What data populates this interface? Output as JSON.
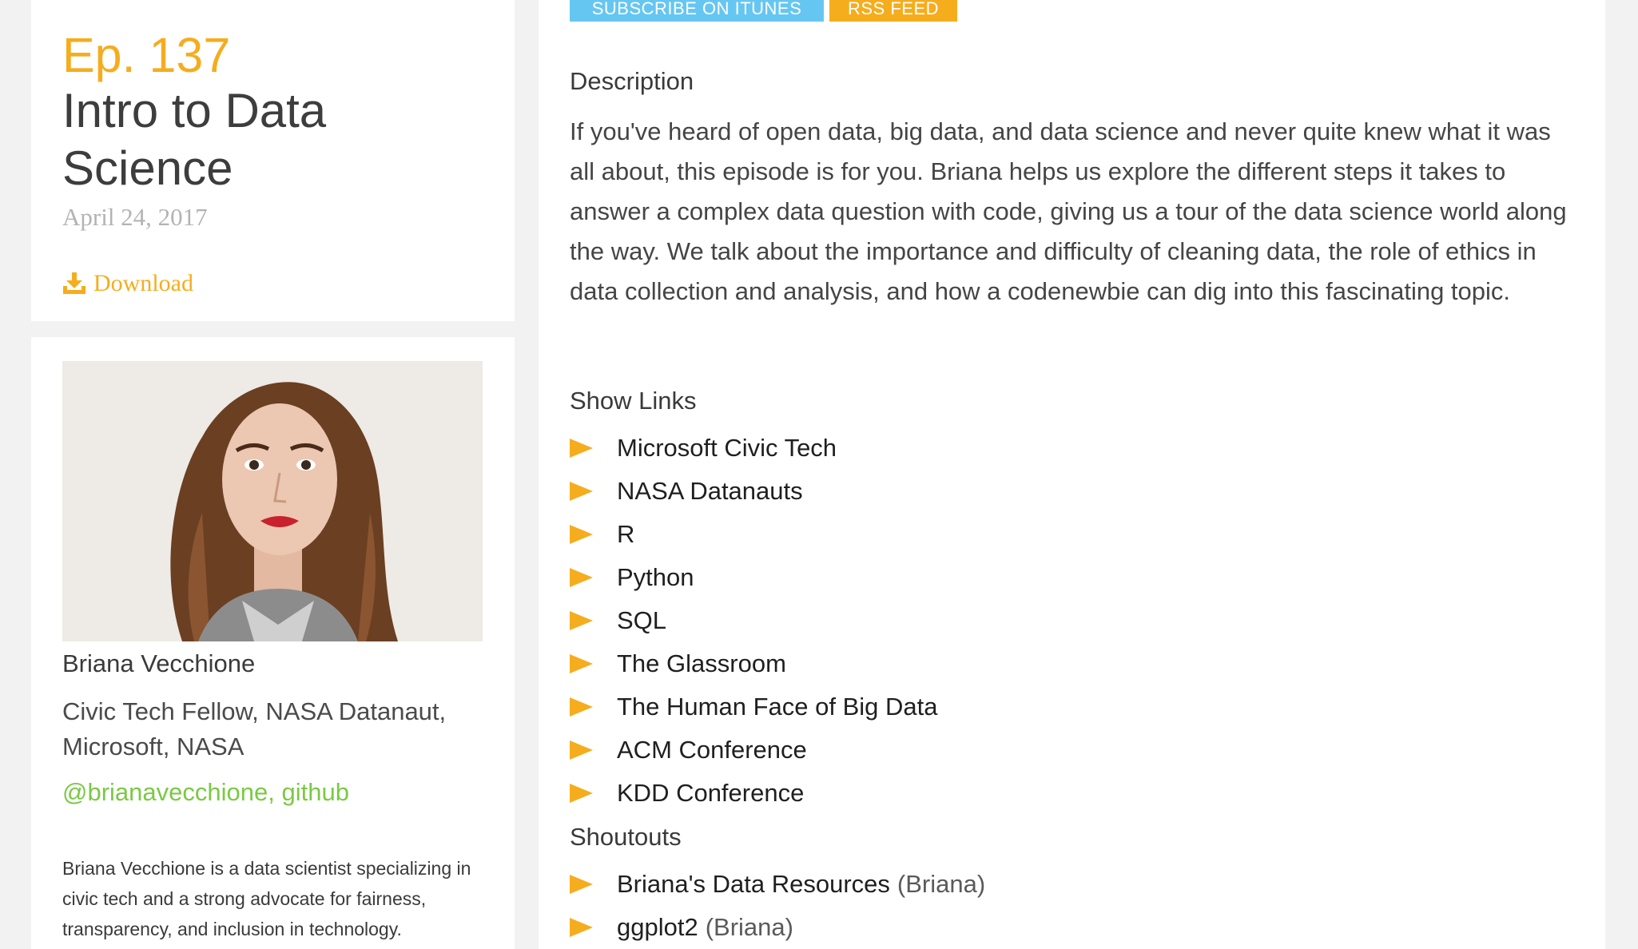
{
  "episode": {
    "number": "Ep. 137",
    "title": "Intro to Data Science",
    "date": "April 24, 2017",
    "download_label": "Download"
  },
  "guest": {
    "name": "Briana Vecchione",
    "role": "Civic Tech Fellow, NASA Datanaut, Microsoft, NASA",
    "twitter": "@brianavecchione",
    "separator": ", ",
    "github": "github",
    "bio": "Briana Vecchione is a data scientist specializing in civic tech and a strong advocate for fairness, transparency, and inclusion in technology."
  },
  "actions": {
    "itunes_label": "SUBSCRIBE ON ITUNES",
    "rss_label": "RSS FEED"
  },
  "description": {
    "heading": "Description",
    "text": "If you've heard of open data, big data, and data science and never quite knew what it was all about, this episode is for you. Briana helps us explore the different steps it takes to answer a complex data question with code, giving us a tour of the data science world along the way. We talk about the importance and difficulty of cleaning data, the role of ethics in data collection and analysis, and how a codenewbie can dig into this fascinating topic."
  },
  "show_links": {
    "heading": "Show Links",
    "items": [
      {
        "label": "Microsoft Civic Tech"
      },
      {
        "label": "NASA Datanauts"
      },
      {
        "label": "R"
      },
      {
        "label": "Python"
      },
      {
        "label": "SQL"
      },
      {
        "label": "The Glassroom"
      },
      {
        "label": "The Human Face of Big Data"
      },
      {
        "label": "ACM Conference"
      },
      {
        "label": "KDD Conference"
      }
    ]
  },
  "shoutouts": {
    "heading": "Shoutouts",
    "items": [
      {
        "label": "Briana's Data Resources",
        "credit": "(Briana)"
      },
      {
        "label": "ggplot2",
        "credit": "(Briana)"
      }
    ]
  },
  "colors": {
    "accent": "#f5ad1e",
    "itunes": "#66c6f2",
    "link_green": "#7ac943",
    "date_grey": "#b3b3b3"
  }
}
